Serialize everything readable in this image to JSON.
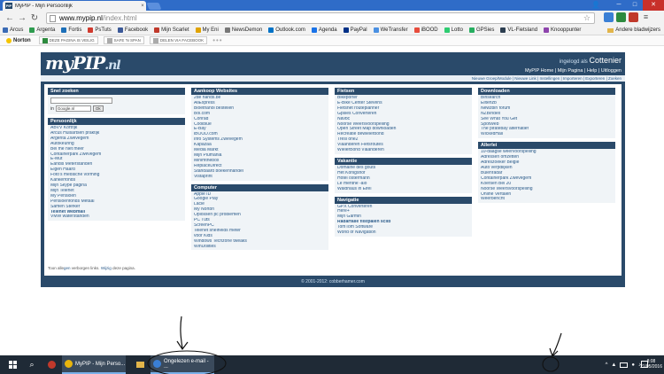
{
  "browser": {
    "tab_title": "MyPIP - Mijn Persoonlijk",
    "tab_favicon": "PIP",
    "url_host": "www.mypip.nl",
    "url_path": "/index.html",
    "extensions": [
      {
        "label": "",
        "color": "#3a7fd5"
      },
      {
        "label": "",
        "color": "#2d8a3e"
      },
      {
        "label": "",
        "color": "#c0392b"
      },
      {
        "label": "≡",
        "color": "#777777"
      }
    ]
  },
  "bookmarks": {
    "items": [
      {
        "label": "Arcus",
        "color": "#3b6bb5"
      },
      {
        "label": "Argenta",
        "color": "#2e9b4f"
      },
      {
        "label": "Fortis",
        "color": "#1c6fb8"
      },
      {
        "label": "PsTuts",
        "color": "#d03a2e"
      },
      {
        "label": "Facebook",
        "color": "#3b5998"
      },
      {
        "label": "Mijn Scarlet",
        "color": "#c0392b"
      },
      {
        "label": "My Eni",
        "color": "#e0a300"
      },
      {
        "label": "NewsDemon",
        "color": "#777777"
      },
      {
        "label": "Outlook.com",
        "color": "#0072c6"
      },
      {
        "label": "Agenda",
        "color": "#1a73e8"
      },
      {
        "label": "PayPal",
        "color": "#003087"
      },
      {
        "label": "WeTransfer",
        "color": "#4a90e2"
      },
      {
        "label": "iBOOD",
        "color": "#e74c3c"
      },
      {
        "label": "Lotto",
        "color": "#2ecc71"
      },
      {
        "label": "GPSies",
        "color": "#27ae60"
      },
      {
        "label": "VL-Fietsland",
        "color": "#2c3e50"
      },
      {
        "label": "Knooppunter",
        "color": "#8e44ad"
      }
    ],
    "other": "Andere bladwijzers"
  },
  "extbar": {
    "norton": "Norton",
    "chip1": "DEZE PAGINA IS VEILIG",
    "chip2": "SAFE 'N SPAN",
    "chip3": "DELEN VIA FACEBOOK",
    "dots": "•••"
  },
  "site": {
    "logo_main": "myPIP",
    "logo_tld": ".nl",
    "login_prefix": "ingelogd als",
    "login_user": "Cottenier",
    "topnav": "MyPIP Home | Mijn Pagina | Help | Uitloggen",
    "subnav": "Nieuwe Groep/Module | Nieuwe Link | Instellingen | Importeren | Exporteren | Zoeken",
    "search": {
      "title": "Snel zoeken",
      "in_label": "in",
      "engine": "Google.nl",
      "button": "Ok"
    },
    "col1": [
      {
        "title": "Persoonlijk",
        "items": [
          "ABVV Kortrijk",
          "Arcus Huisartsen praktijk",
          "Argenta Zwevegem",
          "Autokeuring",
          "Bel me niet meer",
          "Containerpark Zwevegem",
          "E-Mut",
          "Eandis Meterstanden",
          "Eigen Haard",
          "Foto's medische vorming",
          "Kankerfonds",
          "Mijn Skype pagina",
          "Mijn Telenet",
          "My Pensioen",
          "Pensioenfonds Metaal",
          "Samen Sterker",
          "Telenet Webmail",
          "VMW waterstanden"
        ]
      }
    ],
    "col2": [
      {
        "title": "Aankoop Websites",
        "items": [
          "2de hands.be",
          "AliExpress",
          "Bioethanol bestellen",
          "Bol.com",
          "Conrad",
          "Coolblue",
          "E-Bay",
          "iBOOD.com",
          "Info Systems Zwevegem",
          "Kapazaa",
          "Media Markt",
          "Mijn Plumania",
          "Minimthebox",
          "ReplaceDirect",
          "Standaard boekenhandel",
          "Vistaprint"
        ]
      },
      {
        "title": "Computer",
        "items": [
          "Apple ID",
          "Google Play",
          "Lacie",
          "My Norton",
          "Oplossen pc problemen",
          "PC Tuts",
          "ScreenPC",
          "Telenet snelheids meter",
          "voor Kids",
          "Windows Techzone tweaks",
          "WinUtilities"
        ]
      }
    ],
    "col3": [
      {
        "title": "Fietsen",
        "items": [
          "Bikeporter",
          "E-Bike Center Stevens",
          "Fietsnet routeplanner",
          "Gpsies Converteren",
          "Navbc",
          "Noorse Weersvoorspelling",
          "Open Street Map downloaden",
          "Recreatie dewielerbond",
          "Tresi one2",
          "Vlaanderen Fietsroutes",
          "WielerBond Vlaanderen"
        ]
      },
      {
        "title": "Vakantie",
        "items": [
          "Domaine des gouts",
          "Het Konigshof",
          "Hotel ostermann",
          "Le menthe -alo",
          "Waldhaus in Eifel"
        ]
      },
      {
        "title": "Navigatie",
        "items": [
          "GPX Converteren",
          "Here+",
          "Mijn Garmin",
          "Radarfalle flistpalen scilb",
          "TomTom Software",
          "World of Navigation"
        ]
      }
    ],
    "col4": [
      {
        "title": "Downloaden",
        "items": [
          "Binsearch",
          "Elitenzb",
          "Newzbin forum",
          "NZBIndex",
          "See What You Get",
          "SpotWeb",
          "The piratebay alternatief",
          "WickedHall"
        ]
      },
      {
        "title": "Allerlei",
        "items": [
          "10-daagse weervoorspelling",
          "Adressen omzetten",
          "Adreszoeker Belgie",
          "Auto verpdlijken",
          "Buienradar",
          "Containerpark Zwevegem",
          "Koersen Bel 20",
          "Noorse Weersvoorspelling",
          "Online Vertalen",
          "Weerbericht"
        ]
      }
    ],
    "footnote_prefix": "Toon alle",
    "footnote_link1": "gen",
    "footnote_mid": " verborgen links.",
    "footnote_link2": " Wijzig",
    "footnote_suffix": " deze pagina.",
    "footer": "© 2001-2012: cobberhamer.com"
  },
  "taskbar": {
    "window1": "MyPIP - Mijn Perso...",
    "window2": "Ongelezen e-mail - ...",
    "time": "8:08",
    "date": "21/05/2016"
  }
}
